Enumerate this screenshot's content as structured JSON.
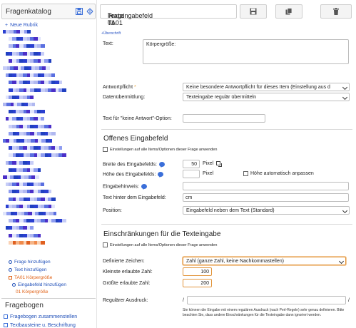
{
  "catalog": {
    "title": "Fragenkatalog",
    "new_rubrik": "Neue Rubrik",
    "tree_links": {
      "frage_hinzufuegen": "Frage hinzufügen",
      "text_hinzufuegen": "Text hinzufügen",
      "ta01": "TA01 Körpergröße",
      "eingabefeld_hinzufuegen": "Eingabefeld hinzufügen",
      "ta01_01": "01 Körpergröße"
    }
  },
  "fragebogen": {
    "title": "Fragebogen",
    "links": [
      "Fragebogen zusammenstellen",
      "Textbausteine u. Beschriftung"
    ]
  },
  "question": {
    "title": "Frage TA01",
    "bullet": "•",
    "subtitle": "Texteingabefeld 01",
    "ueberschrift_link": "+Überschrift",
    "text_label": "Text:",
    "text_value": "Körpergröße:",
    "antwortpflicht_label": "Antwortpflicht",
    "antwortpflicht_req": "*",
    "antwortpflicht_value": "Keine besondere Antwortpflicht für dieses Item (Einstellung aus d",
    "datenuebermittlung_label": "Datenübermittlung:",
    "datenuebermittlung_value": "Texteingabe regulär übermitteln",
    "keine_antwort_label": "Text für \"keine Antwort\"-Option:",
    "keine_antwort_value": ""
  },
  "eingabefeld": {
    "heading": "Offenes Eingabefeld",
    "apply_all": "Einstellungen auf alle Items/Optionen dieser Frage anwenden",
    "breite_label": "Breite des Eingabefelds:",
    "breite_value": "50",
    "breite_unit": "Pixel",
    "hoehe_label": "Höhe des Eingabefelds:",
    "hoehe_value": "",
    "hoehe_unit": "Pixel",
    "hoehe_auto": "Höhe automatisch anpassen",
    "hinweis_label": "Eingabehinweis:",
    "hinweis_value": "",
    "hinter_label": "Text hinter dem Eingabefeld:",
    "hinter_value": "cm",
    "position_label": "Position:",
    "position_value": "Eingabefeld neben dem Text (Standard)"
  },
  "einschraenkungen": {
    "heading": "Einschränkungen für die Texteingabe",
    "apply_all": "Einstellungen auf alle Items/Optionen dieser Frage anwenden",
    "zeichen_label": "Definierte Zeichen:",
    "zeichen_value": "Zahl (ganze Zahl, keine Nachkommastellen)",
    "min_label": "Kleinste erlaubte Zahl:",
    "min_value": "100",
    "max_label": "Größte erlaubte Zahl:",
    "max_value": "200",
    "regex_label": "Regulärer Ausdruck:",
    "regex_slash": "/",
    "regex_value": "",
    "regex_help": "Sie können die Eingabe mit einem regulären Ausdruck (nach Perl-Regeln) sehr genau definieren. Bitte beachten Sie, dass andere Einschränkungen für die Texteingabe dann ignoriert werden."
  },
  "colors": {
    "accent": "#3b6fd9",
    "active": "#e05e10",
    "focus": "#e2953c"
  }
}
